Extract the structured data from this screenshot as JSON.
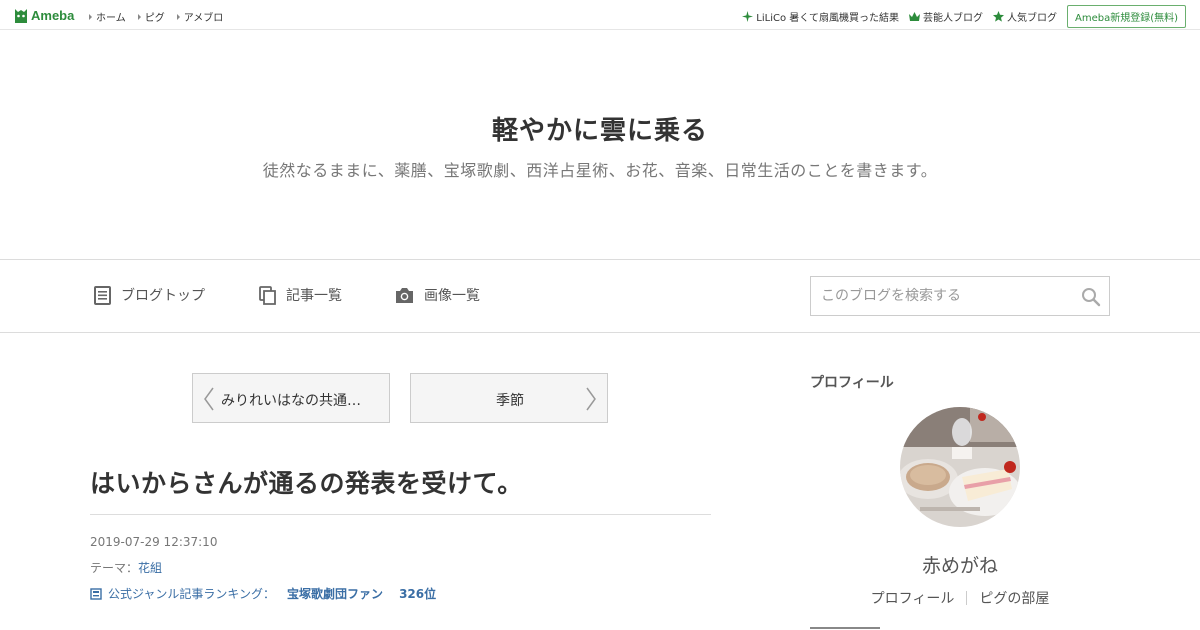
{
  "topbar": {
    "logo": "Ameba",
    "nav": [
      "ホーム",
      "ピグ",
      "アメブロ"
    ],
    "trend_link": "LiLiCo 暑くて扇風機買った結果",
    "celebrity_link": "芸能人ブログ",
    "popular_link": "人気ブログ",
    "register_button": "Ameba新規登録(無料)"
  },
  "blog": {
    "title": "軽やかに雲に乗る",
    "description": "徒然なるままに、薬膳、宝塚歌劇、西洋占星術、お花、音楽、日常生活のことを書きます。"
  },
  "nav": {
    "top": "ブログトップ",
    "entries": "記事一覧",
    "images": "画像一覧",
    "search_placeholder": "このブログを検索する"
  },
  "article": {
    "prev_label": "みりれいはなの共通…",
    "next_label": "季節",
    "title": "はいからさんが通るの発表を受けて。",
    "date": "2019-07-29 12:37:10",
    "theme_prefix": "テーマ：",
    "theme": "花組",
    "ranking_label": "公式ジャンル記事ランキング：",
    "ranking_genre": "宝塚歌劇団ファン",
    "ranking_rank": "326位"
  },
  "sidebar": {
    "heading": "プロフィール",
    "name": "赤めがね",
    "profile_link": "プロフィール",
    "room_link": "ピグの部屋"
  },
  "colors": {
    "brand_green": "#2d8c3c",
    "link_blue": "#3a6ea5"
  }
}
